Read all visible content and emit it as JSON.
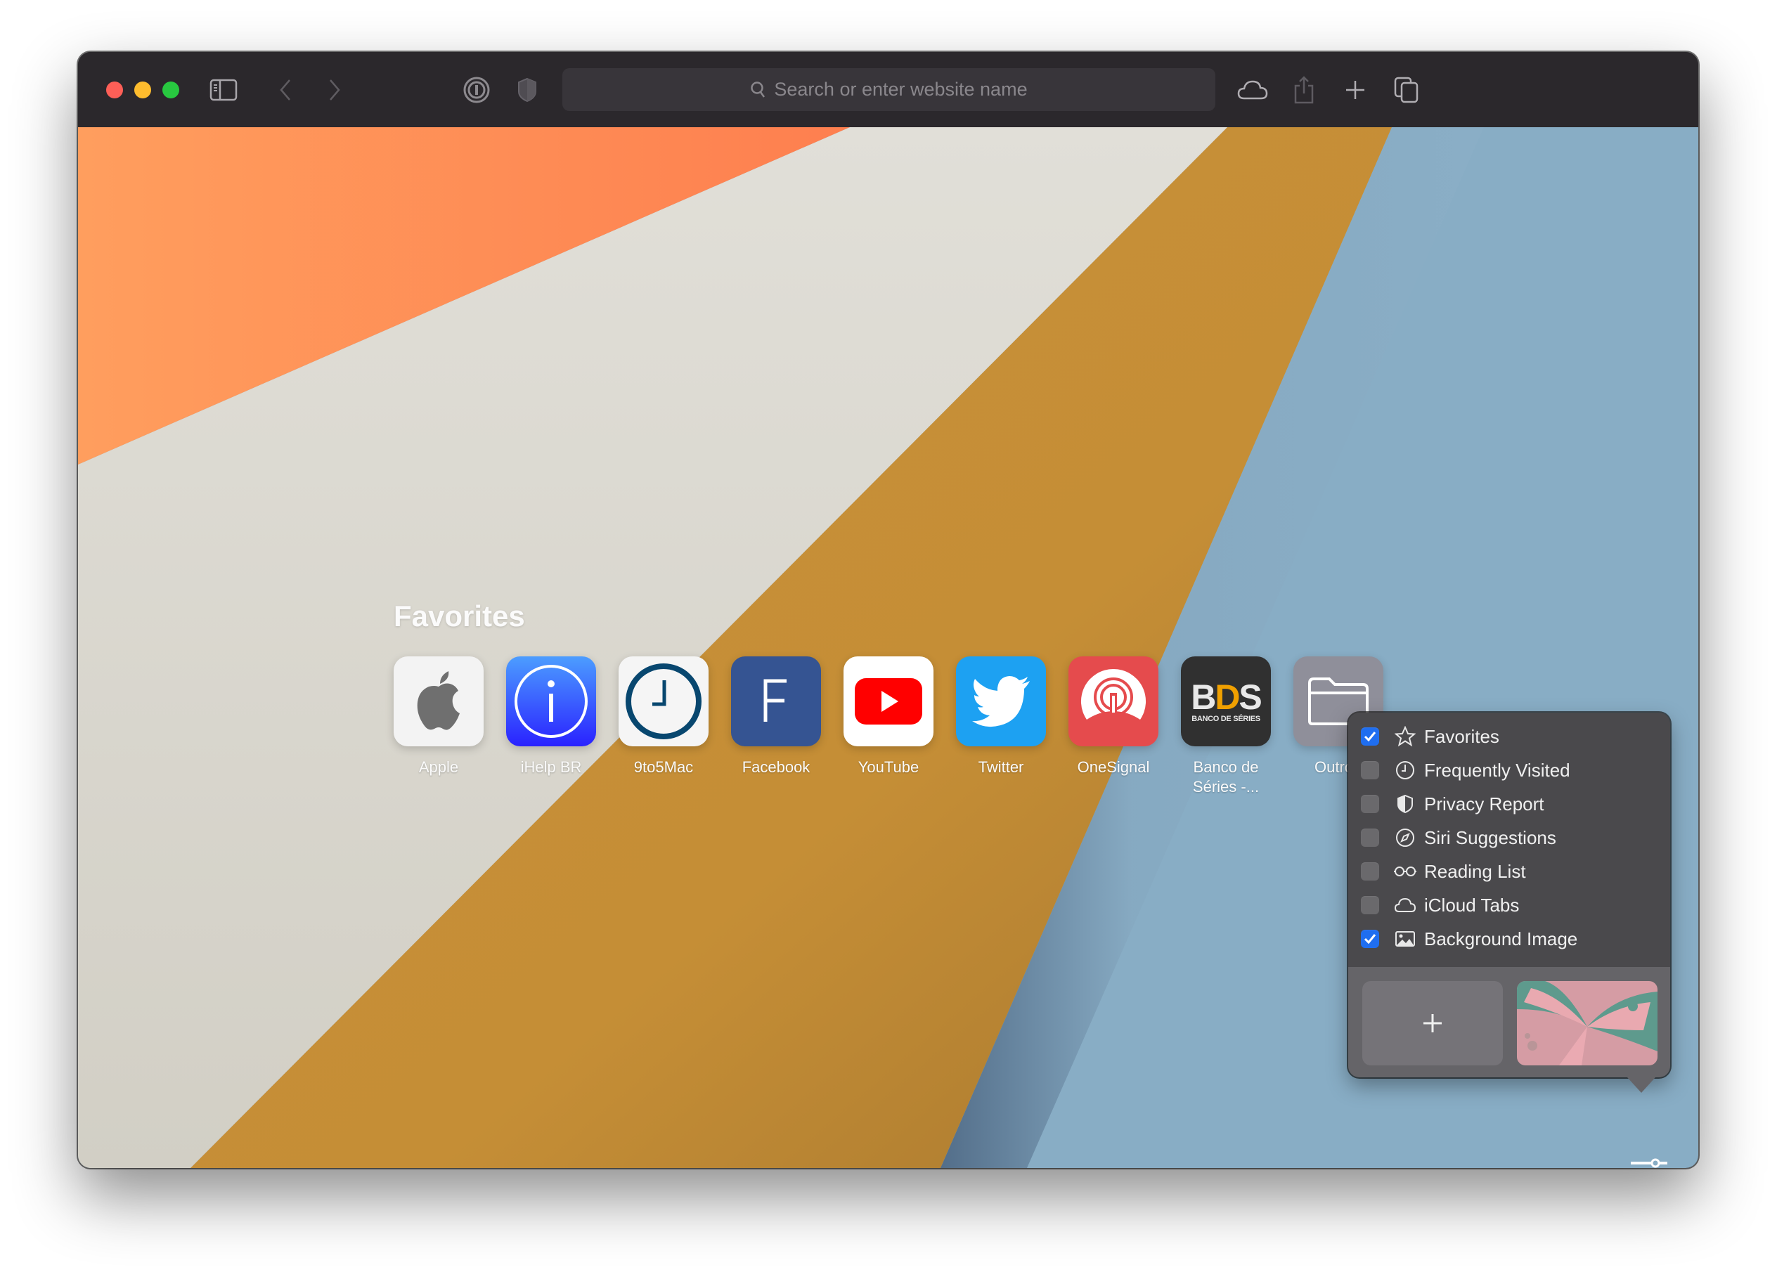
{
  "toolbar": {
    "traffic_lights": [
      "close",
      "minimize",
      "zoom"
    ],
    "sidebar_icon": "sidebar-icon",
    "back_icon": "chevron-left-icon",
    "forward_icon": "chevron-right-icon",
    "password_icon": "1password-icon",
    "privacy_icon": "shield-icon",
    "address_placeholder": "Search or enter website name",
    "icloud_icon": "cloud-icon",
    "share_icon": "share-icon",
    "new_tab_icon": "plus-icon",
    "tabs_overview_icon": "tabs-overview-icon"
  },
  "favorites": {
    "title": "Favorites",
    "items": [
      {
        "label": "Apple",
        "icon": "apple-logo-icon",
        "bg": "#f3f3f3"
      },
      {
        "label": "iHelp BR",
        "icon": "info-icon",
        "bg": "#3b6cff"
      },
      {
        "label": "9to5Mac",
        "icon": "clock-icon",
        "bg": "#f5f5f5"
      },
      {
        "label": "Facebook",
        "icon": "letter-f-icon",
        "bg": "#355492"
      },
      {
        "label": "YouTube",
        "icon": "youtube-play-icon",
        "bg": "#ffffff"
      },
      {
        "label": "Twitter",
        "icon": "twitter-bird-icon",
        "bg": "#1da1f2"
      },
      {
        "label": "OneSignal",
        "icon": "onesignal-icon",
        "bg": "#e54b4d"
      },
      {
        "label": "Banco de Séries -...",
        "label_line1": "Banco de",
        "label_line2": "Séries -...",
        "icon": "bds-logo-icon",
        "bg": "#303030",
        "logo_text": "BDS",
        "logo_sub": "BANCO DE SÉRIES"
      },
      {
        "label": "Outros",
        "label_visible": "Outro",
        "icon": "folder-icon",
        "bg": "#8f8f9a"
      }
    ]
  },
  "customize_menu": {
    "items": [
      {
        "label": "Favorites",
        "icon": "star-icon",
        "checked": true
      },
      {
        "label": "Frequently Visited",
        "icon": "clock-icon",
        "checked": false
      },
      {
        "label": "Privacy Report",
        "icon": "shield-icon",
        "checked": false
      },
      {
        "label": "Siri Suggestions",
        "icon": "compass-icon",
        "checked": false
      },
      {
        "label": "Reading List",
        "icon": "glasses-icon",
        "checked": false
      },
      {
        "label": "iCloud Tabs",
        "icon": "cloud-icon",
        "checked": false
      },
      {
        "label": "Background Image",
        "icon": "photo-icon",
        "checked": true
      }
    ],
    "add_background_icon": "plus-icon",
    "thumbnail": "butterfly-wallpaper-thumbnail"
  },
  "customize_button_icon": "sliders-icon",
  "colors": {
    "toolbar": "#2b282c",
    "checkbox_on": "#1f6ef0",
    "bg_orange": "#fe8a55",
    "bg_cream": "#dddbd4",
    "bg_gold": "#c48f36",
    "bg_blue": "#88adc5"
  }
}
